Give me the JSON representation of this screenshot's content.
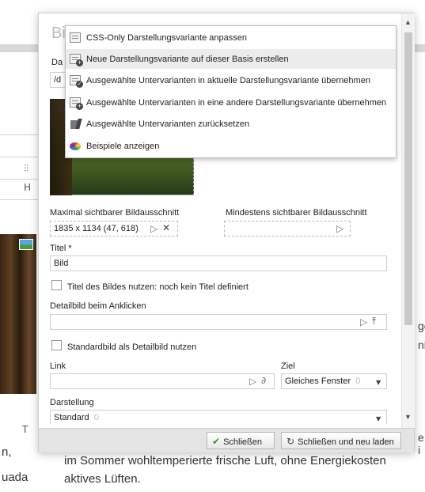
{
  "background": {
    "text_lines": [
      "im Sommer wohltemperierte frische Luft, ohne Energiekosten",
      "aktives Lüften."
    ],
    "right_fragments": [
      "ge",
      "nit",
      "e i"
    ],
    "left_fragments": [
      "n,",
      "uada"
    ]
  },
  "dialog": {
    "title_partial": "Bi",
    "field_label_partial": "Da",
    "field_value_partial": "/d",
    "max_crop_label": "Maximal sichtbarer Bildausschnitt",
    "max_crop_value": "1835 x 1134 (47, 618)",
    "min_crop_label": "Mindestens sichtbarer Bildausschnitt",
    "title_label": "Titel *",
    "title_value": "Bild",
    "use_image_title_label": "Titel des Bildes nutzen: noch kein Titel definiert",
    "detail_image_label": "Detailbild beim Anklicken",
    "standard_as_detail_label": "Standardbild als Detailbild nutzen",
    "link_label": "Link",
    "target_label": "Ziel",
    "target_value": "Gleiches Fenster",
    "target_count": "0",
    "display_label": "Darstellung",
    "display_value": "Standard",
    "display_count": "0",
    "close_button": "Schließen",
    "close_reload_button": "Schließen und neu laden"
  },
  "menu": {
    "items": [
      {
        "label": "CSS-Only Darstellungsvariante anpassen",
        "icon": "document-icon"
      },
      {
        "label": "Neue Darstellungsvariante auf dieser Basis erstellen",
        "icon": "document-add-icon"
      },
      {
        "label": "Ausgewählte Untervarianten in aktuelle Darstellungsvariante übernehmen",
        "icon": "document-apply-icon"
      },
      {
        "label": "Ausgewählte Untervarianten in eine andere Darstellungsvariante übernehmen",
        "icon": "document-add-icon"
      },
      {
        "label": "Ausgewählte Untervarianten zurücksetzen",
        "icon": "reset-icon"
      },
      {
        "label": "Beispiele anzeigen",
        "icon": "palette-icon"
      }
    ]
  },
  "colors": {
    "menu_highlight": "#ececec",
    "footer": "#e4e4e4",
    "check_green": "#2e9b2e"
  }
}
